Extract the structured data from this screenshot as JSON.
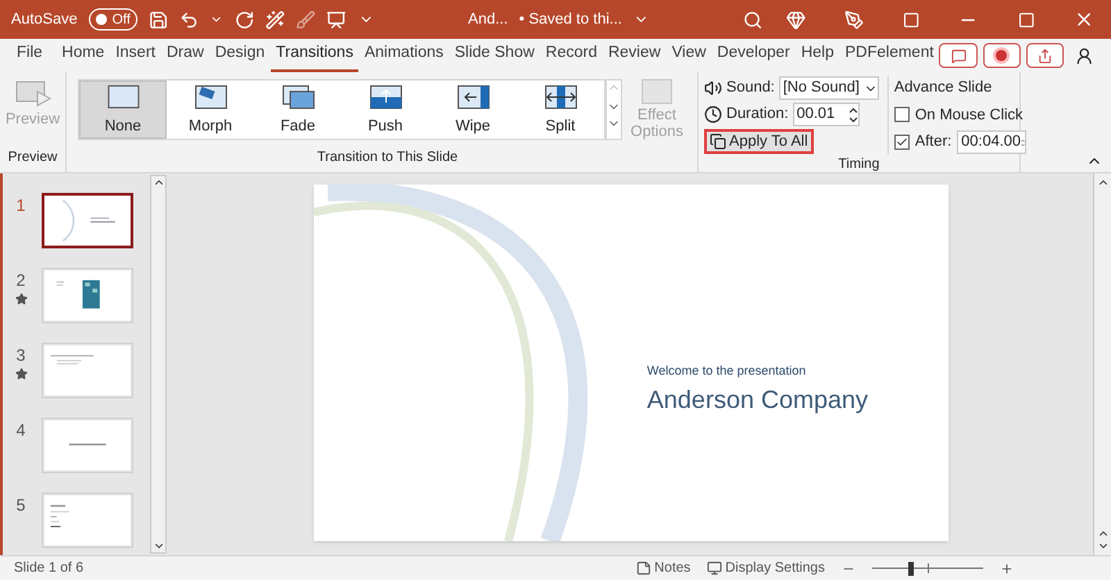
{
  "title_bar": {
    "autosave_label": "AutoSave",
    "autosave_toggle": {
      "label": "Off",
      "on": false
    },
    "document_name": "And...",
    "save_status": "• Saved to thi..."
  },
  "ribbon_tabs": [
    {
      "label": "File",
      "selected": false
    },
    {
      "label": "Home",
      "selected": false
    },
    {
      "label": "Insert",
      "selected": false
    },
    {
      "label": "Draw",
      "selected": false
    },
    {
      "label": "Design",
      "selected": false
    },
    {
      "label": "Transitions",
      "selected": true
    },
    {
      "label": "Animations",
      "selected": false
    },
    {
      "label": "Slide Show",
      "selected": false
    },
    {
      "label": "Record",
      "selected": false
    },
    {
      "label": "Review",
      "selected": false
    },
    {
      "label": "View",
      "selected": false
    },
    {
      "label": "Developer",
      "selected": false
    },
    {
      "label": "Help",
      "selected": false
    },
    {
      "label": "PDFelement",
      "selected": false
    }
  ],
  "preview_group": {
    "button": {
      "label": "Preview",
      "disabled": true
    },
    "group_label": "Preview"
  },
  "transitions_group": {
    "items": [
      {
        "label": "None",
        "selected": true
      },
      {
        "label": "Morph",
        "selected": false
      },
      {
        "label": "Fade",
        "selected": false
      },
      {
        "label": "Push",
        "selected": false
      },
      {
        "label": "Wipe",
        "selected": false
      },
      {
        "label": "Split",
        "selected": false
      }
    ],
    "effect_options": {
      "label": "Effect Options",
      "disabled": true
    },
    "group_label": "Transition to This Slide"
  },
  "timing_group": {
    "sound": {
      "label": "Sound:",
      "value": "[No Sound]"
    },
    "duration": {
      "label": "Duration:",
      "value": "00.01"
    },
    "apply_to_all": {
      "label": "Apply To All",
      "highlighted": true
    },
    "advance_slide": {
      "title": "Advance Slide",
      "on_mouse_click": {
        "label": "On Mouse Click",
        "checked": false
      },
      "after": {
        "label": "After:",
        "checked": true,
        "value": "00:04.00"
      }
    },
    "group_label": "Timing"
  },
  "slides": [
    {
      "number": "1",
      "selected": true,
      "has_transition": false
    },
    {
      "number": "2",
      "selected": false,
      "has_transition": true
    },
    {
      "number": "3",
      "selected": false,
      "has_transition": true
    },
    {
      "number": "4",
      "selected": false,
      "has_transition": false
    },
    {
      "number": "5",
      "selected": false,
      "has_transition": false
    }
  ],
  "current_slide": {
    "subtitle": "Welcome to the presentation",
    "title": "Anderson Company"
  },
  "status_bar": {
    "slide_counter": "Slide 1 of 6",
    "notes": "Notes",
    "display_settings": "Display Settings",
    "zoom": {
      "level": 0.35
    }
  }
}
